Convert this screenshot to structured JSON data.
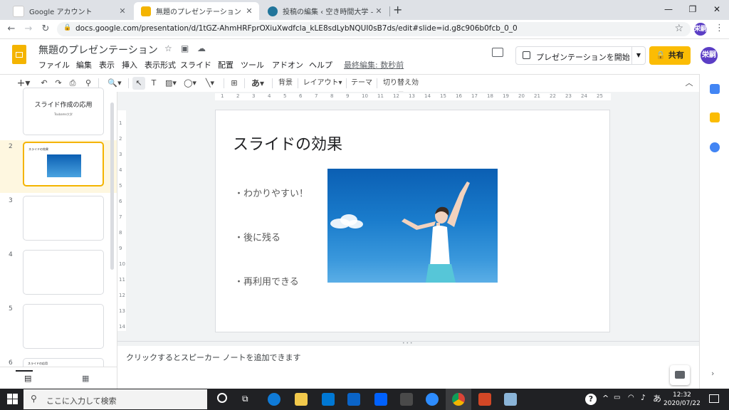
{
  "browser": {
    "tabs": [
      {
        "title": "Google アカウント",
        "fav_color": "#4285f4"
      },
      {
        "title": "無題のプレゼンテーション - Google ス",
        "fav_color": "#f4b400"
      },
      {
        "title": "投稿の編集 ‹ 空き時間大学 — Wo",
        "fav_color": "#21759b"
      }
    ],
    "new_tab": "+",
    "url": "docs.google.com/presentation/d/1tGZ-AhmHRFprOXiuXwdfcla_kLE8sdLybNQUI0sB7ds/edit#slide=id.g8c906b0fcb_0_0",
    "profile": "栄嗣"
  },
  "header": {
    "doc_title": "無題のプレゼンテーション",
    "menus": [
      "ファイル",
      "編集",
      "表示",
      "挿入",
      "表示形式",
      "スライド",
      "配置",
      "ツール",
      "アドオン",
      "ヘルプ"
    ],
    "last_edit": "最終編集: 数秒前",
    "present_label": "プレゼンテーションを開始",
    "share_label": "共有",
    "profile": "栄嗣"
  },
  "toolbar": {
    "text_tool": "あ",
    "background": "背景",
    "layout": "レイアウト▾",
    "theme": "テーマ",
    "transition": "切り替え効果"
  },
  "filmstrip": {
    "slide1_title": "スライド作成の応用",
    "slide1_sub": "Tsubame大学",
    "numbers": [
      "2",
      "3",
      "4",
      "5",
      "6"
    ],
    "slide2_title": "スライドの効果",
    "slide6_title": "スライドの応用"
  },
  "ruler": {
    "h": [
      "1",
      "2",
      "3",
      "4",
      "5",
      "6",
      "7",
      "8",
      "9",
      "10",
      "11",
      "12",
      "13",
      "14",
      "15",
      "16",
      "17",
      "18",
      "19",
      "20",
      "21",
      "22",
      "23",
      "24",
      "25"
    ],
    "v": [
      "1",
      "2",
      "3",
      "4",
      "5",
      "6",
      "7",
      "8",
      "9",
      "10",
      "11",
      "12",
      "13",
      "14"
    ]
  },
  "slide": {
    "title": "スライドの効果",
    "bullets": [
      "・わかりやすい！",
      "・後に残る",
      "・再利用できる"
    ]
  },
  "notes": {
    "placeholder": "クリックするとスピーカー ノートを追加できます"
  },
  "taskbar": {
    "search": "ここに入力して検索",
    "time": "12:32",
    "date": "2020/07/22",
    "ime": "あ"
  }
}
